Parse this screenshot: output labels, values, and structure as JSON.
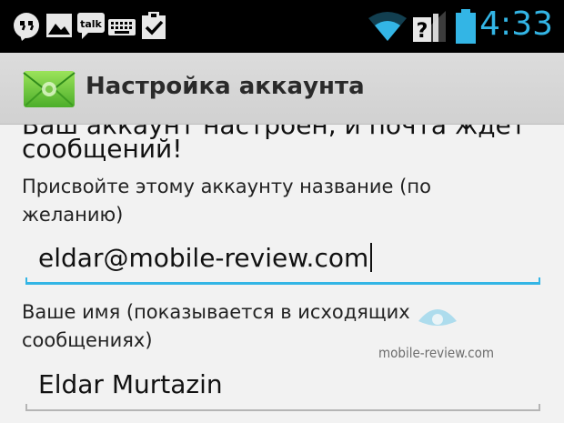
{
  "status_bar": {
    "time": "4:33",
    "icons": [
      "hangouts-icon",
      "gallery-icon",
      "talk-icon",
      "keyboard-icon",
      "clipboard-check-icon",
      "wifi-icon",
      "no-sim-icon",
      "battery-icon"
    ],
    "talk_label": "talk",
    "accent": "#33b5e5"
  },
  "action_bar": {
    "title": "Настройка аккаунта",
    "icon": "email-envelope-icon"
  },
  "form": {
    "cut_line": "Ваш аккаунт настроен, и почта ждет",
    "intro": "сообщений!",
    "account_name_label": "Присвойте этому аккаунту название (по желанию)",
    "account_name_value": "eldar@mobile-review.com",
    "your_name_label": "Ваше имя (показывается в исходящих сообщениях)",
    "your_name_value": "Eldar Murtazin"
  },
  "watermark": {
    "text": "mobile-review.com"
  }
}
